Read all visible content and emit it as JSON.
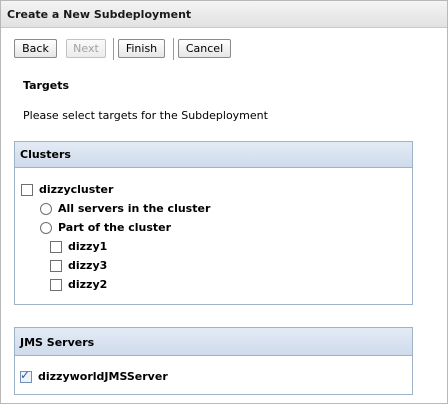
{
  "window": {
    "title": "Create a New Subdeployment"
  },
  "toolbar": {
    "back_label": "Back",
    "next_label": "Next",
    "finish_label": "Finish",
    "cancel_label": "Cancel"
  },
  "content": {
    "heading": "Targets",
    "instruction": "Please select targets for the Subdeployment"
  },
  "clusters": {
    "header": "Clusters",
    "cluster": {
      "label": "dizzycluster",
      "checked": false
    },
    "options": [
      {
        "label": "All servers in the cluster",
        "selected": false
      },
      {
        "label": "Part of the cluster",
        "selected": false
      }
    ],
    "servers": [
      {
        "label": "dizzy1",
        "checked": false
      },
      {
        "label": "dizzy3",
        "checked": false
      },
      {
        "label": "dizzy2",
        "checked": false
      }
    ]
  },
  "jms": {
    "header": "JMS Servers",
    "servers": [
      {
        "label": "dizzyworldJMSServer",
        "checked": true
      }
    ]
  },
  "icons": {
    "check": "checkmark-icon"
  }
}
